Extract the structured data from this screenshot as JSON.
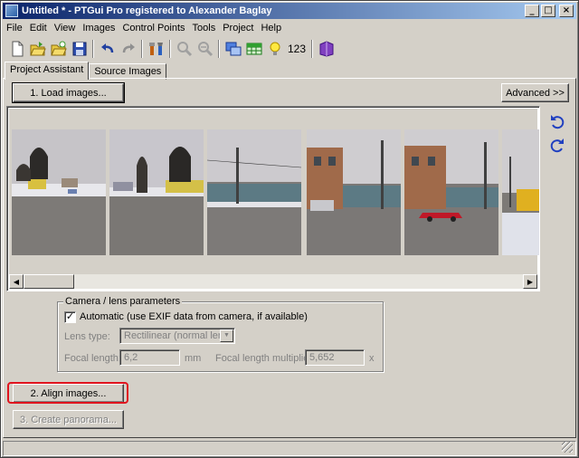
{
  "window": {
    "title": "Untitled * - PTGui Pro registered to Alexander Baglay",
    "controls": {
      "minimize": "_",
      "maximize": "□",
      "close": "×"
    }
  },
  "menu": [
    "File",
    "Edit",
    "View",
    "Images",
    "Control Points",
    "Tools",
    "Project",
    "Help"
  ],
  "toolbar": {
    "icons": [
      "new-project-icon",
      "open-project-icon",
      "open-recent-icon",
      "save-icon",
      "undo-icon",
      "redo-icon",
      "tools-icon",
      "zoom-in-icon",
      "zoom-out-icon",
      "panorama-editor-icon",
      "table-icon",
      "bulb-icon",
      "numbering-icon",
      "help-book-icon"
    ],
    "numbering_label": "123"
  },
  "tabs": [
    "Project Assistant",
    "Source Images"
  ],
  "buttons": {
    "load_images": "1. Load images...",
    "advanced": "Advanced >>",
    "align_images": "2. Align images...",
    "create_panorama": "3. Create panorama..."
  },
  "camera": {
    "group_title": "Camera / lens parameters",
    "automatic_label": "Automatic (use EXIF data from camera, if available)",
    "automatic_checked": true,
    "lens_type_label": "Lens type:",
    "lens_type_value": "Rectilinear (normal lens)",
    "focal_length_label": "Focal length:",
    "focal_length_value": "6,2",
    "focal_length_unit": "mm",
    "multiplier_label": "Focal length multiplier:",
    "multiplier_value": "5,652",
    "multiplier_unit": "x"
  },
  "colors": {
    "title_gradient_start": "#0a246a",
    "title_gradient_end": "#a6caf0",
    "face": "#d4d0c8",
    "highlight_ring": "#e0141e"
  },
  "thumbnails": [
    "image-1",
    "image-2",
    "image-3",
    "image-4",
    "image-5",
    "image-6"
  ]
}
